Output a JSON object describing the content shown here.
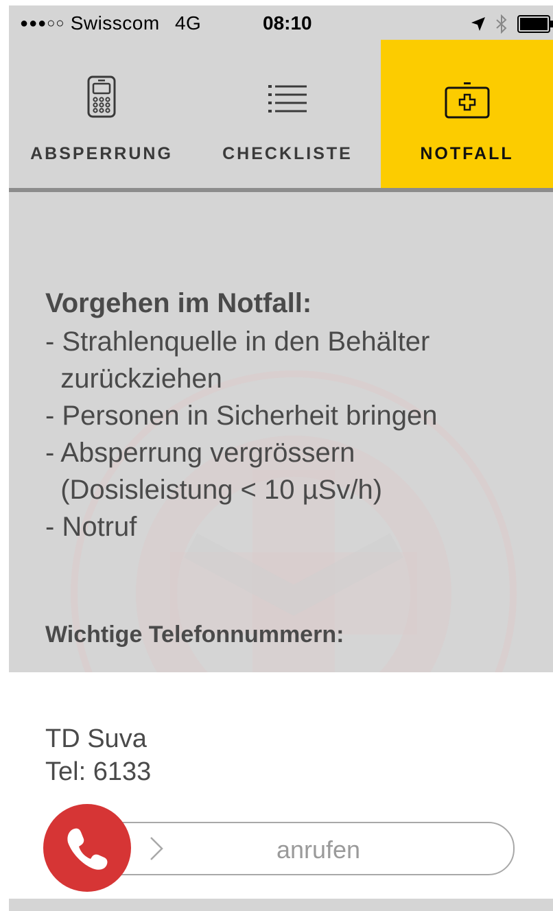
{
  "status_bar": {
    "signal": "●●●○○",
    "carrier": "Swisscom",
    "network": "4G",
    "time": "08:10",
    "icons": [
      "location-arrow-icon",
      "bluetooth-icon",
      "battery-icon"
    ]
  },
  "tabs": [
    {
      "label": "ABSPERRUNG",
      "icon": "phone-keypad-icon",
      "active": false
    },
    {
      "label": "CHECKLISTE",
      "icon": "list-icon",
      "active": false
    },
    {
      "label": "NOTFALL",
      "icon": "first-aid-kit-icon",
      "active": true
    }
  ],
  "colors": {
    "active_tab": "#fccc00",
    "background": "#d5d5d5",
    "call_button": "#d63535",
    "text": "#4a4a4a"
  },
  "emergency": {
    "title": "Vorgehen im Notfall:",
    "steps": [
      "- Strahlenquelle in den Behälter",
      "  zurückziehen",
      "- Personen in Sicherheit bringen",
      "- Absperrung vergrössern",
      "  (Dosisleistung < 10 µSv/h)",
      "- Notruf"
    ]
  },
  "phones_heading": "Wichtige Telefonnummern:",
  "contact": {
    "name": "TD Suva",
    "tel": "Tel: 6133",
    "slider_label": "anrufen"
  }
}
